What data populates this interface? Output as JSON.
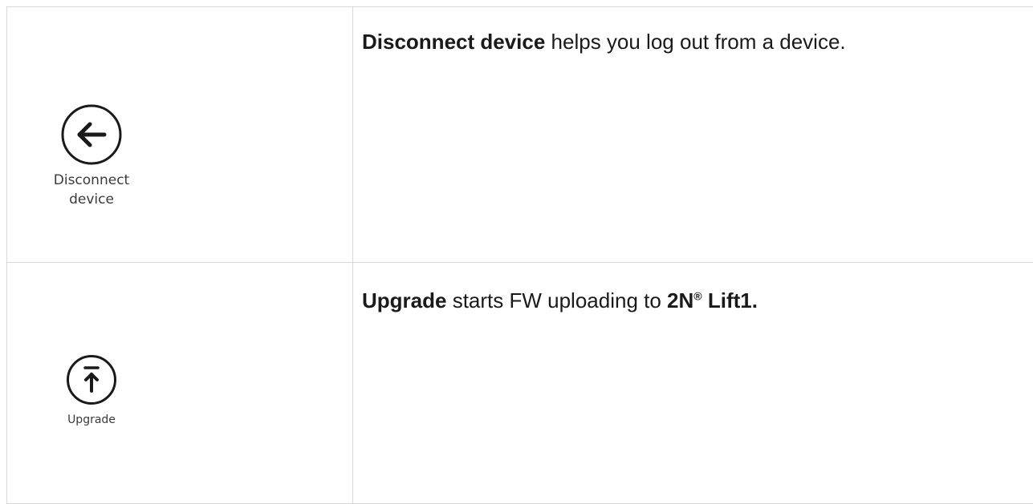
{
  "rows": [
    {
      "tool": {
        "icon": "arrow-left-circle-icon",
        "label": "Disconnect\ndevice"
      },
      "description": {
        "bold_term": "Disconnect device",
        "text": " helps you log out from a device."
      }
    },
    {
      "tool": {
        "icon": "upload-circle-icon",
        "label": "Upgrade"
      },
      "description": {
        "bold_term": "Upgrade",
        "text": " starts FW uploading to ",
        "product_name": "2N",
        "registered_mark": "®",
        "product_model": " Lift1."
      }
    }
  ]
}
